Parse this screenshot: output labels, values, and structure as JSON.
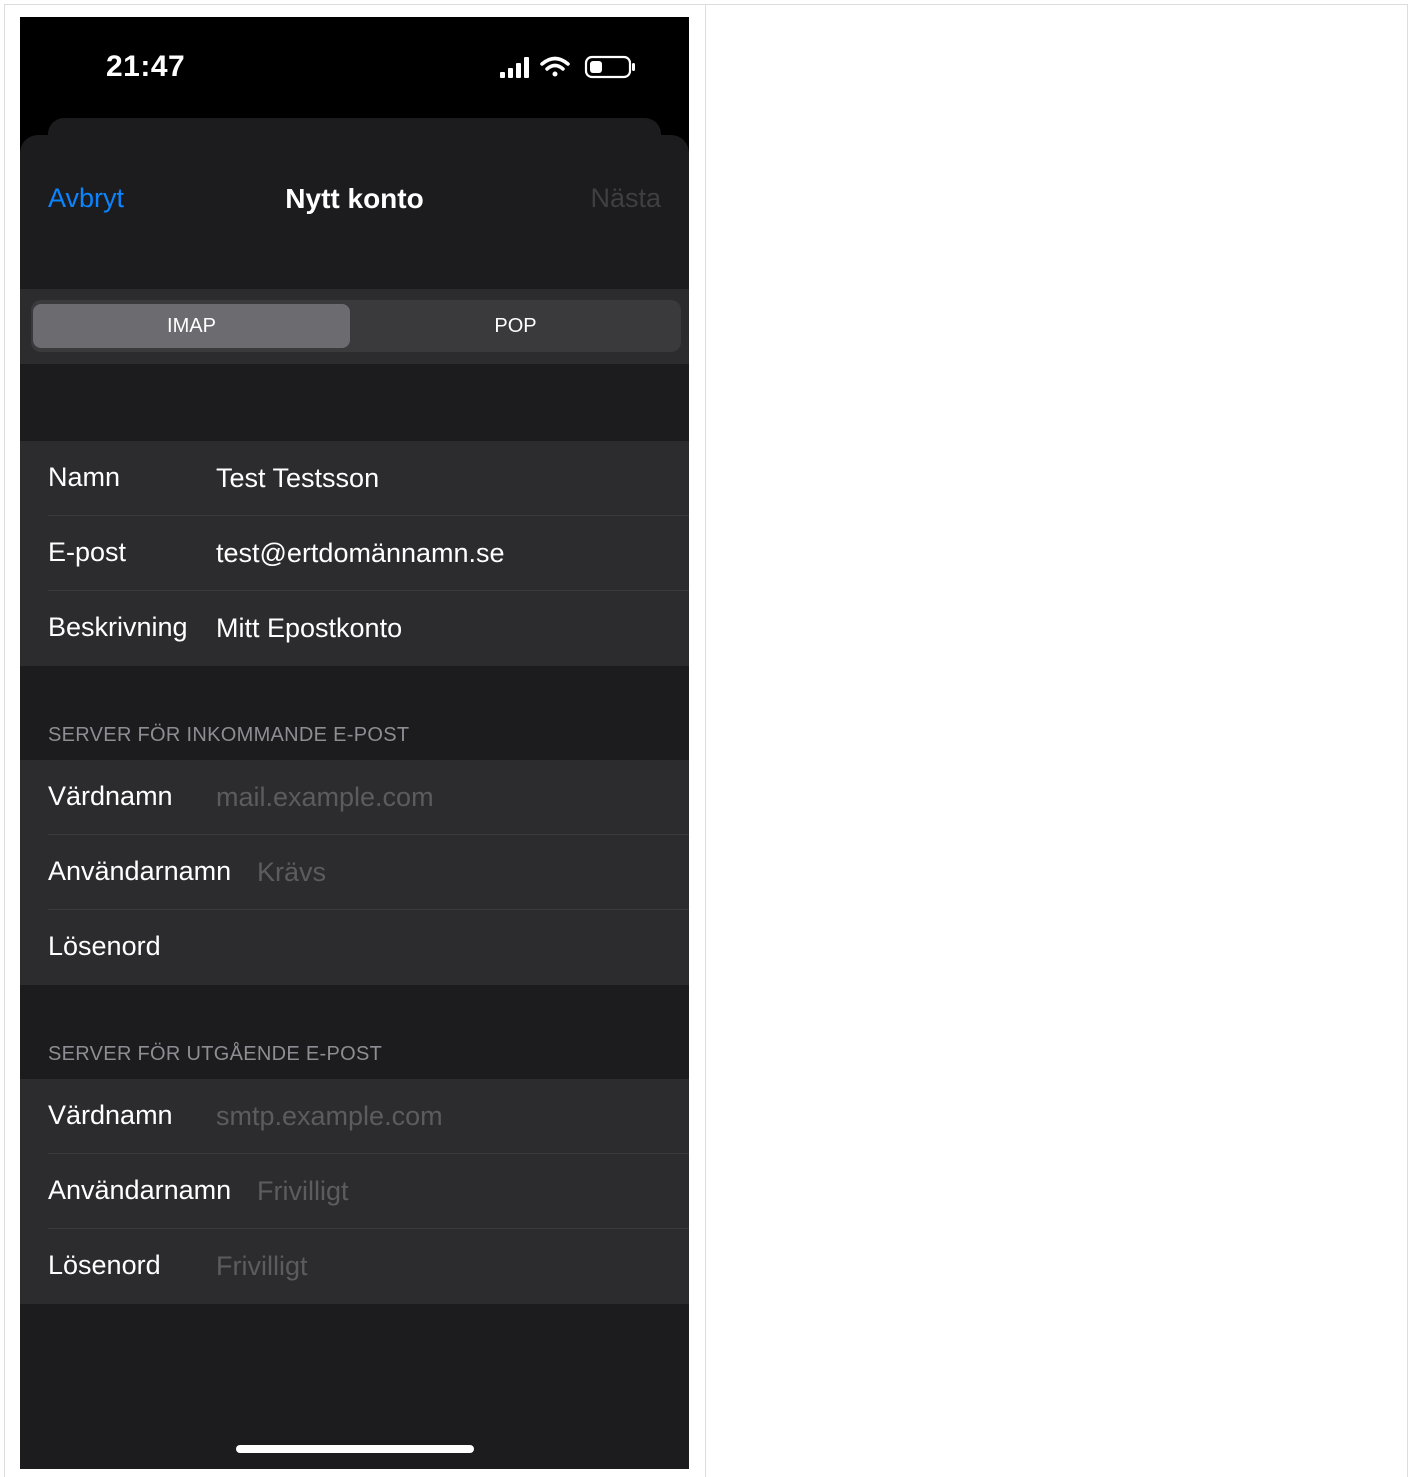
{
  "status_bar": {
    "time": "21:47",
    "icons": [
      "cellular-signal-icon",
      "wifi-icon",
      "battery-icon"
    ]
  },
  "nav": {
    "cancel_label": "Avbryt",
    "title": "Nytt konto",
    "next_label": "Nästa"
  },
  "segment": {
    "options": [
      "IMAP",
      "POP"
    ],
    "selected": "IMAP"
  },
  "account": {
    "name_label": "Namn",
    "name_value": "Test Testsson",
    "email_label": "E-post",
    "email_value": "test@ertdomännamn.se",
    "description_label": "Beskrivning",
    "description_value": "Mitt Epostkonto"
  },
  "incoming": {
    "header": "SERVER FÖR INKOMMANDE E-POST",
    "host_label": "Värdnamn",
    "host_placeholder": "mail.example.com",
    "user_label": "Användarnamn",
    "user_placeholder": "Krävs",
    "password_label": "Lösenord",
    "password_placeholder": ""
  },
  "outgoing": {
    "header": "SERVER FÖR UTGÅENDE E-POST",
    "host_label": "Värdnamn",
    "host_placeholder": "smtp.example.com",
    "user_label": "Användarnamn",
    "user_placeholder": "Frivilligt",
    "password_label": "Lösenord",
    "password_placeholder": "Frivilligt"
  },
  "colors": {
    "accent": "#0a84ff",
    "background": "#1c1c1e",
    "cell": "#2c2c2e",
    "placeholder": "#5c5c60",
    "section_header": "#8d8d93"
  }
}
